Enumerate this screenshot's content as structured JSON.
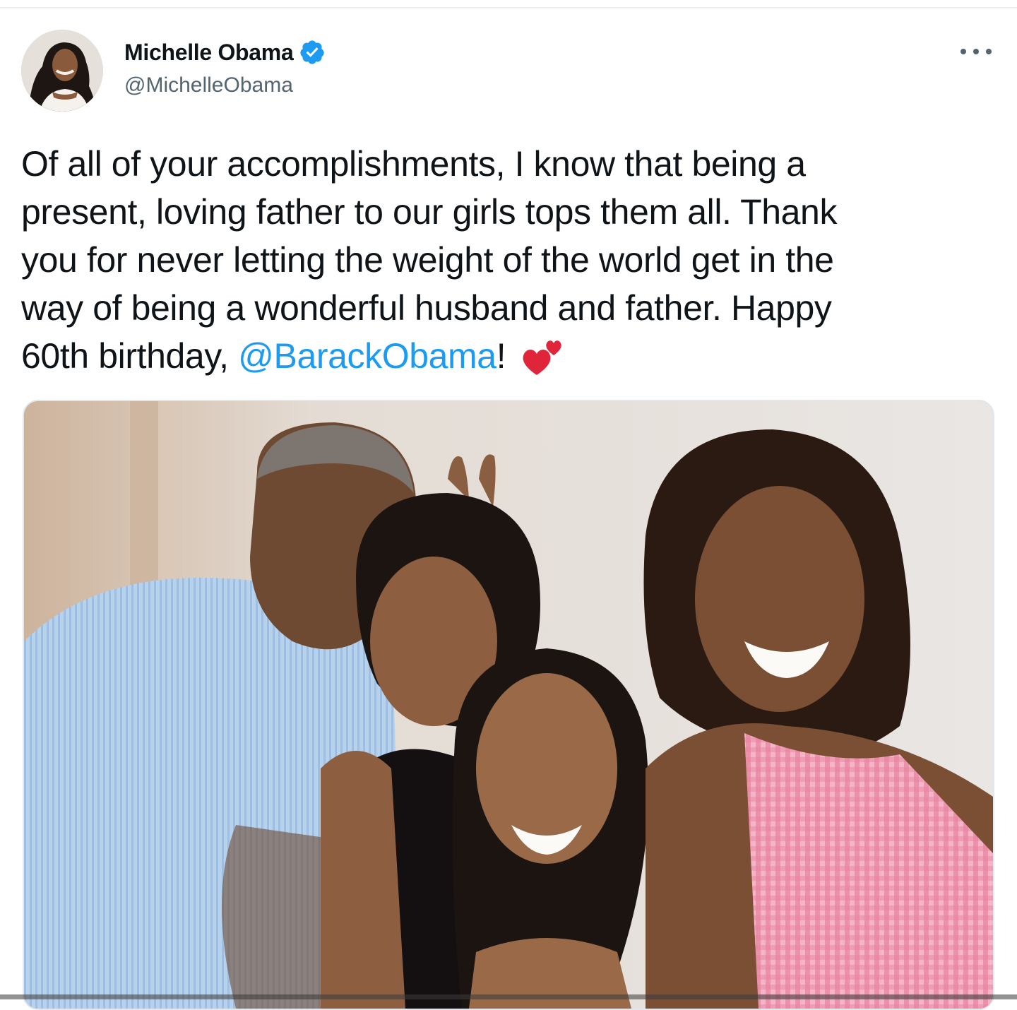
{
  "tweet": {
    "author": {
      "display_name": "Michelle Obama",
      "handle": "@MichelleObama",
      "verified": true
    },
    "text_lines": [
      "Of all of your accomplishments, I know that being a",
      "present, loving father to our girls tops them all. Thank",
      "you for never letting the weight of the world get in the",
      "way of being a wonderful husband and father. Happy"
    ],
    "last_line": {
      "before_mention": "60th birthday, ",
      "mention": "@BarackObama",
      "after_mention": "!",
      "emoji": "two-hearts-emoji"
    },
    "media": {
      "type": "photo",
      "icon": "family-photo"
    }
  },
  "colors": {
    "link": "#1d9bf0",
    "secondary_text": "#536471",
    "primary_text": "#0f1419",
    "verified": "#1d9bf0",
    "heart": "#e0243a"
  }
}
